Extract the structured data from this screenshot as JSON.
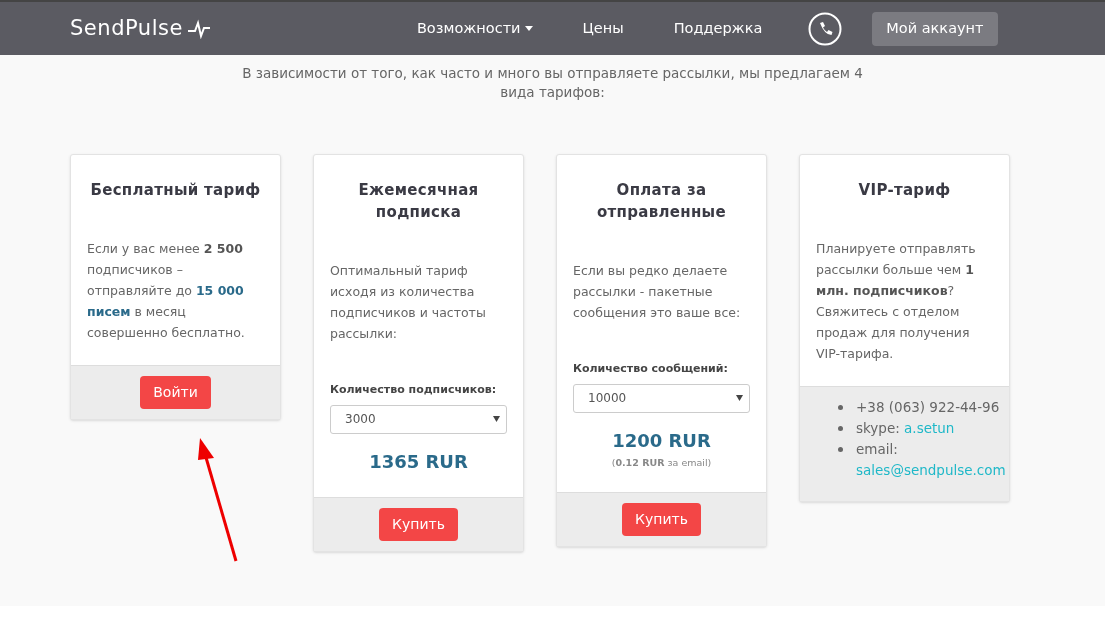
{
  "header": {
    "logo": "SendPulse",
    "nav": [
      {
        "label": "Возможности",
        "dropdown": true
      },
      {
        "label": "Цены",
        "dropdown": false
      },
      {
        "label": "Поддержка",
        "dropdown": false
      }
    ],
    "account_button": "Мой аккаунт"
  },
  "intro": "В зависимости от того, как часто и много вы отправляете рассылки, мы предлагаем 4 вида тарифов:",
  "plans": [
    {
      "title": "Бесплатный тариф",
      "description": [
        {
          "text": "Если у вас менее ",
          "kind": "plain"
        },
        {
          "text": "2 500",
          "kind": "bold"
        },
        {
          "text": " подписчиков – отправляйте до ",
          "kind": "plain"
        },
        {
          "text": "15 000 писем",
          "kind": "highlight"
        },
        {
          "text": " в месяц совершенно бесплатно.",
          "kind": "plain"
        }
      ],
      "footer": {
        "kind": "button",
        "label": "Войти"
      }
    },
    {
      "title": "Ежемесячная подписка",
      "description": [
        {
          "text": "Оптимальный тариф исходя из количества подписчиков и частоты рассылки:",
          "kind": "plain"
        }
      ],
      "select_label": "Количество подписчиков:",
      "select_value": "3000",
      "price": "1365 RUR",
      "footer": {
        "kind": "button",
        "label": "Купить"
      }
    },
    {
      "title": "Оплата за отправленные",
      "description": [
        {
          "text": "Если вы редко делаете рассылки - пакетные сообщения это ваше все:",
          "kind": "plain"
        }
      ],
      "select_label": "Количество сообщений:",
      "select_value": "10000",
      "price": "1200 RUR",
      "price_note": "(**0.12 RUR** за email)",
      "footer": {
        "kind": "button",
        "label": "Купить"
      }
    },
    {
      "title": "VIP-тариф",
      "description": [
        {
          "text": "Планируете отправлять рассылки больше чем ",
          "kind": "plain"
        },
        {
          "text": "1 млн. подписчиков",
          "kind": "bold"
        },
        {
          "text": "? Свяжитесь с отделом продаж для получения VIP-тарифа.",
          "kind": "plain"
        }
      ],
      "footer": {
        "kind": "contacts",
        "items": [
          {
            "label": "+38 (063) 922-44-96"
          },
          {
            "label": "skype:",
            "link": "a.setun"
          },
          {
            "label": "email:",
            "link": "sales@sendpulse.com"
          }
        ]
      }
    }
  ]
}
